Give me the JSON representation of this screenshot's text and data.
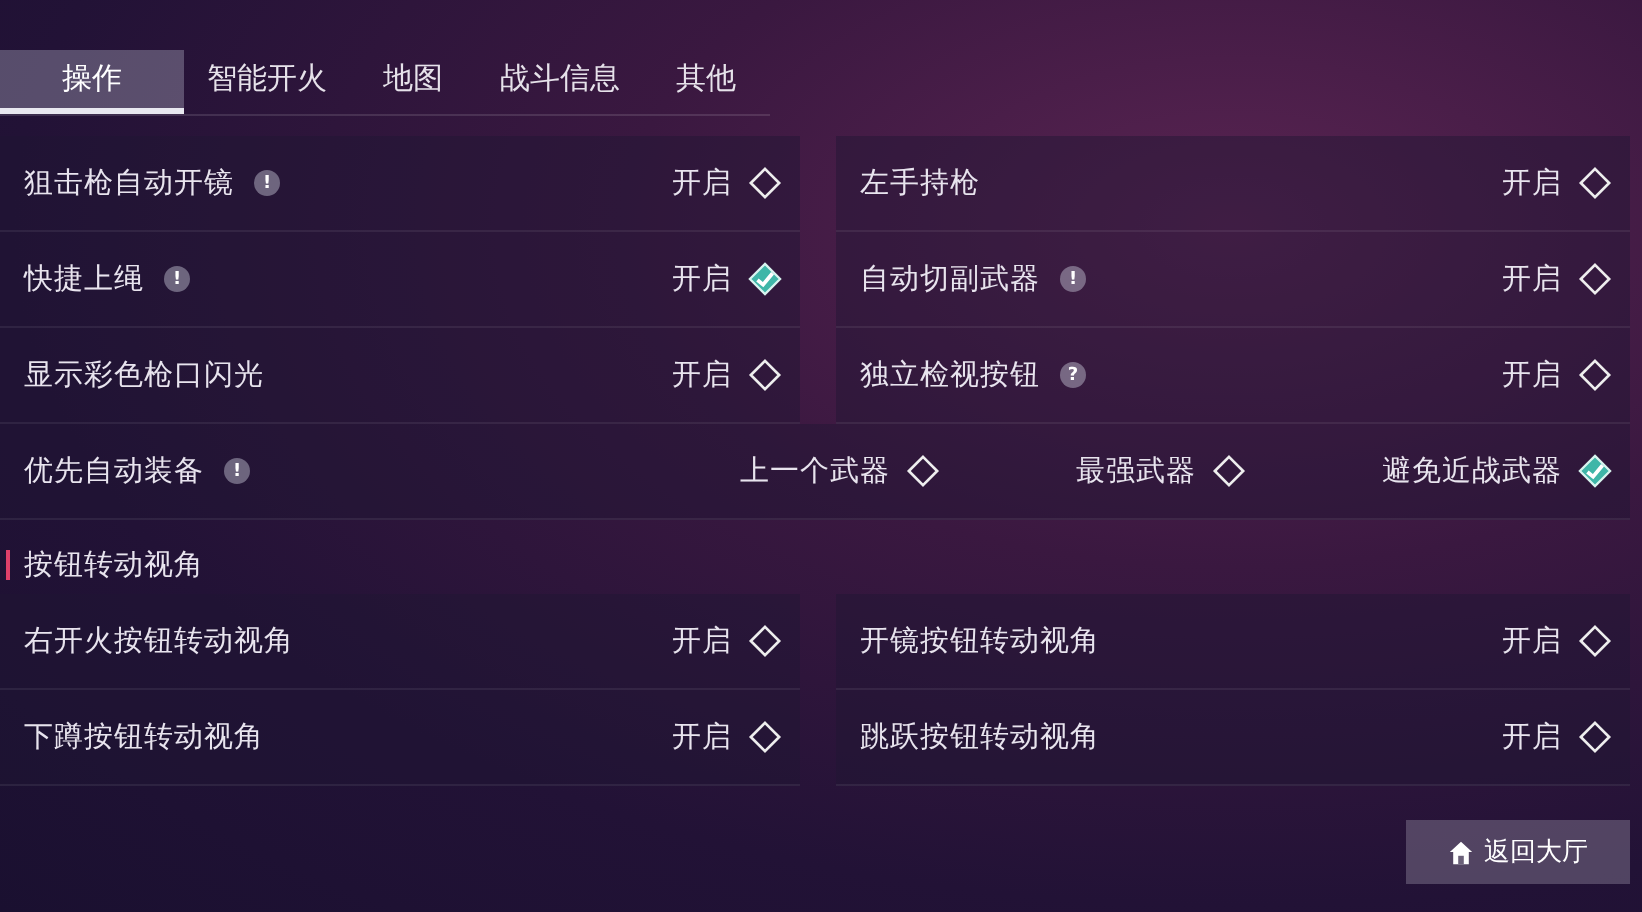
{
  "tabs": [
    {
      "label": "操作",
      "selected": true
    },
    {
      "label": "智能开火",
      "selected": false
    },
    {
      "label": "地图",
      "selected": false
    },
    {
      "label": "战斗信息",
      "selected": false
    },
    {
      "label": "其他",
      "selected": false
    }
  ],
  "sections": [
    {
      "rows": [
        {
          "kind": "toggle",
          "label": "狙击枪自动开镜",
          "hint": "!",
          "value": "开启",
          "checked": false
        },
        {
          "kind": "toggle",
          "label": "左手持枪",
          "value": "开启",
          "checked": false
        },
        {
          "kind": "toggle",
          "label": "快捷上绳",
          "hint": "!",
          "value": "开启",
          "checked": true
        },
        {
          "kind": "toggle",
          "label": "自动切副武器",
          "hint": "!",
          "value": "开启",
          "checked": false
        },
        {
          "kind": "toggle",
          "label": "显示彩色枪口闪光",
          "value": "开启",
          "checked": false
        },
        {
          "kind": "toggle",
          "label": "独立检视按钮",
          "hint": "?",
          "value": "开启",
          "checked": false
        },
        {
          "kind": "choice",
          "label": "优先自动装备",
          "hint": "!",
          "options": [
            {
              "label": "上一个武器",
              "selected": false
            },
            {
              "label": "最强武器",
              "selected": false
            },
            {
              "label": "避免近战武器",
              "selected": true
            }
          ]
        }
      ]
    },
    {
      "title": "按钮转动视角",
      "rows": [
        {
          "kind": "toggle",
          "label": "右开火按钮转动视角",
          "value": "开启",
          "checked": false
        },
        {
          "kind": "toggle",
          "label": "开镜按钮转动视角",
          "value": "开启",
          "checked": false
        },
        {
          "kind": "toggle",
          "label": "下蹲按钮转动视角",
          "value": "开启",
          "checked": false
        },
        {
          "kind": "toggle",
          "label": "跳跃按钮转动视角",
          "value": "开启",
          "checked": false
        }
      ]
    }
  ],
  "back_button": {
    "label": "返回大厅"
  }
}
